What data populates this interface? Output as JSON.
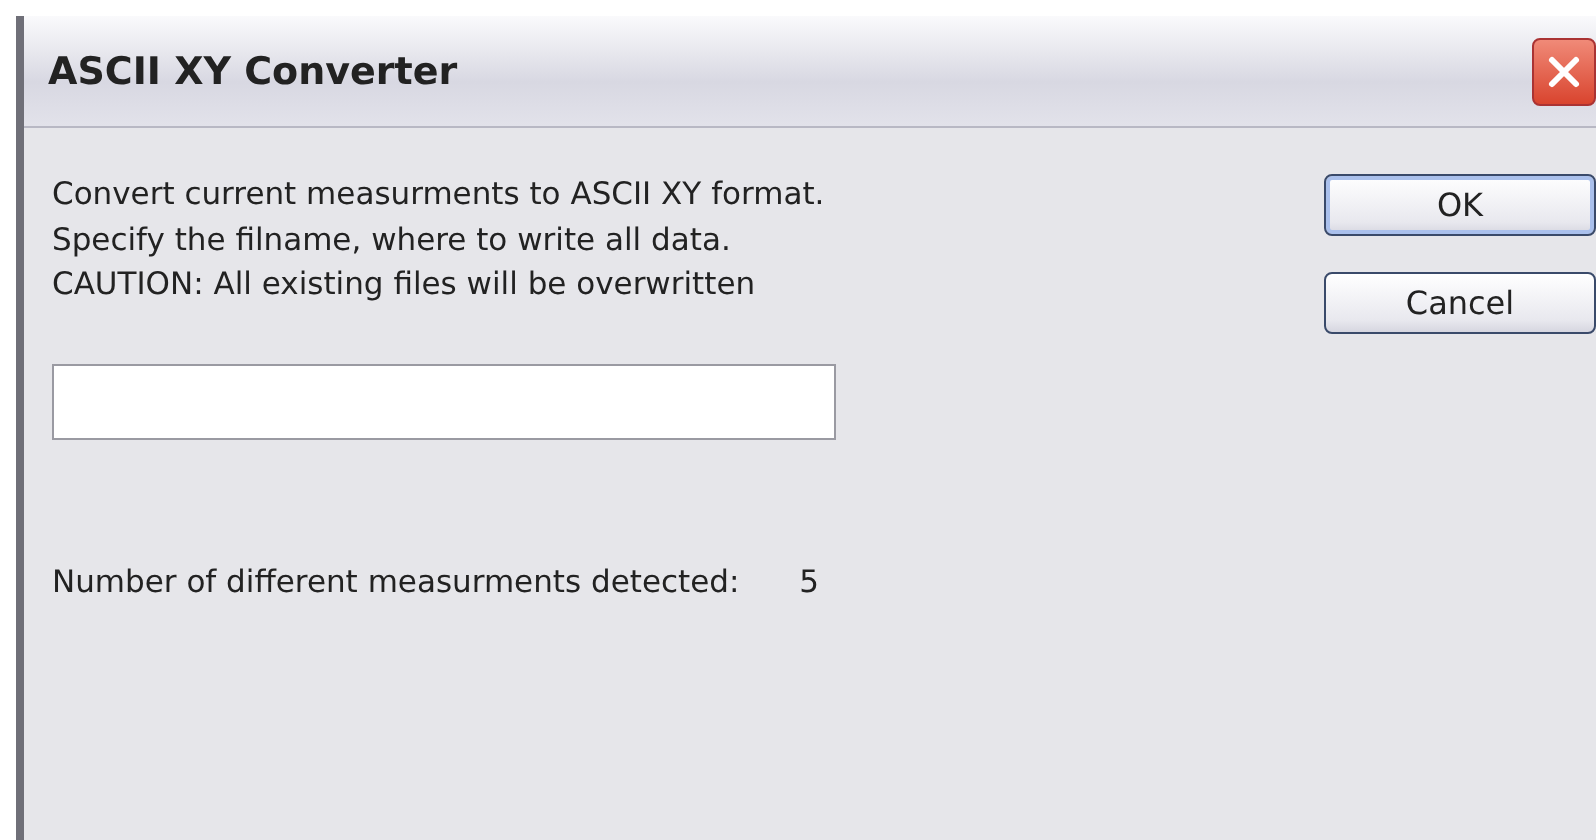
{
  "window": {
    "title": "ASCII XY Converter"
  },
  "message_lines": [
    "Convert current measurments to ASCII XY format.",
    "Specify the filname, where to write all data.",
    "CAUTION: All existing files will be overwritten"
  ],
  "count": {
    "label": "Number of different measurments detected:",
    "value": "5"
  },
  "buttons": [
    "OK",
    "Cancel"
  ]
}
